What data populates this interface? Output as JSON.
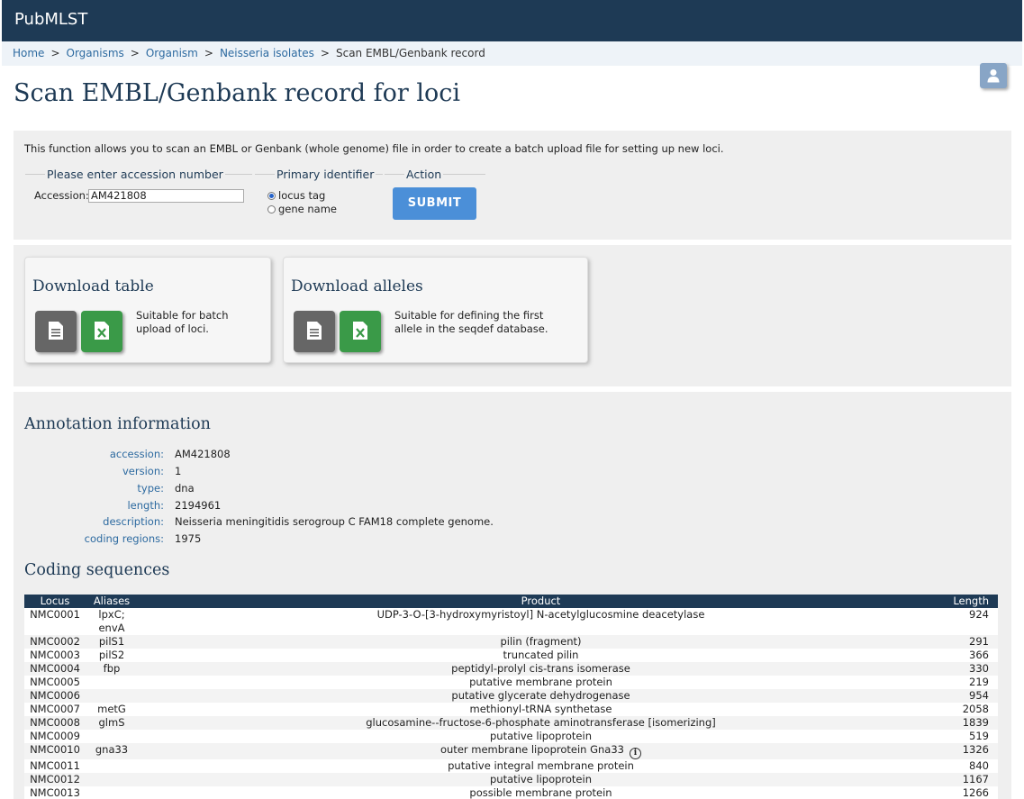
{
  "app": {
    "brand": "PubMLST"
  },
  "breadcrumb": {
    "items": [
      "Home",
      "Organisms",
      "Organism",
      "Neisseria isolates"
    ],
    "current": "Scan EMBL/Genbank record",
    "separator": ">"
  },
  "page": {
    "title": "Scan EMBL/Genbank record for loci"
  },
  "form": {
    "intro": "This function allows you to scan an EMBL or Genbank (whole genome) file in order to create a batch upload file for setting up new loci.",
    "accession_legend": "Please enter accession number",
    "accession_label": "Accession:",
    "accession_value": "AM421808",
    "primary_legend": "Primary identifier",
    "primary_options": [
      "locus tag",
      "gene name"
    ],
    "primary_selected": "locus tag",
    "action_legend": "Action",
    "submit_label": "SUBMIT"
  },
  "downloads": {
    "table": {
      "title": "Download table",
      "desc_line1": "Suitable for batch",
      "desc_line2": "upload of loci."
    },
    "alleles": {
      "title": "Download alleles",
      "desc_line1": "Suitable for defining the first",
      "desc_line2": "allele in the seqdef database."
    }
  },
  "annotation": {
    "title": "Annotation information",
    "fields": [
      {
        "key": "accession:",
        "value": "AM421808"
      },
      {
        "key": "version:",
        "value": "1"
      },
      {
        "key": "type:",
        "value": "dna"
      },
      {
        "key": "length:",
        "value": "2194961"
      },
      {
        "key": "description:",
        "value": "Neisseria meningitidis serogroup C FAM18 complete genome."
      },
      {
        "key": "coding regions:",
        "value": "1975"
      }
    ]
  },
  "coding": {
    "title": "Coding sequences",
    "headers": [
      "Locus",
      "Aliases",
      "Product",
      "Length"
    ],
    "rows": [
      {
        "locus": "NMC0001",
        "aliases": "lpxC; envA",
        "product": "UDP-3-O-[3-hydroxymyristoyl] N-acetylglucosmine deacetylase",
        "length": "924"
      },
      {
        "locus": "NMC0002",
        "aliases": "pilS1",
        "product": "pilin (fragment)",
        "length": "291"
      },
      {
        "locus": "NMC0003",
        "aliases": "pilS2",
        "product": "truncated pilin",
        "length": "366"
      },
      {
        "locus": "NMC0004",
        "aliases": "fbp",
        "product": "peptidyl-prolyl cis-trans isomerase",
        "length": "330"
      },
      {
        "locus": "NMC0005",
        "aliases": "",
        "product": "putative membrane protein",
        "length": "219"
      },
      {
        "locus": "NMC0006",
        "aliases": "",
        "product": "putative glycerate dehydrogenase",
        "length": "954"
      },
      {
        "locus": "NMC0007",
        "aliases": "metG",
        "product": "methionyl-tRNA synthetase",
        "length": "2058"
      },
      {
        "locus": "NMC0008",
        "aliases": "glmS",
        "product": "glucosamine--fructose-6-phosphate aminotransferase [isomerizing]",
        "length": "1839"
      },
      {
        "locus": "NMC0009",
        "aliases": "",
        "product": "putative lipoprotein",
        "length": "519"
      },
      {
        "locus": "NMC0010",
        "aliases": "gna33",
        "product": "outer membrane lipoprotein Gna33",
        "length": "1326",
        "info": true
      },
      {
        "locus": "NMC0011",
        "aliases": "",
        "product": "putative integral membrane protein",
        "length": "840"
      },
      {
        "locus": "NMC0012",
        "aliases": "",
        "product": "putative lipoprotein",
        "length": "1167"
      },
      {
        "locus": "NMC0013",
        "aliases": "",
        "product": "possible membrane protein",
        "length": "1266"
      }
    ]
  }
}
